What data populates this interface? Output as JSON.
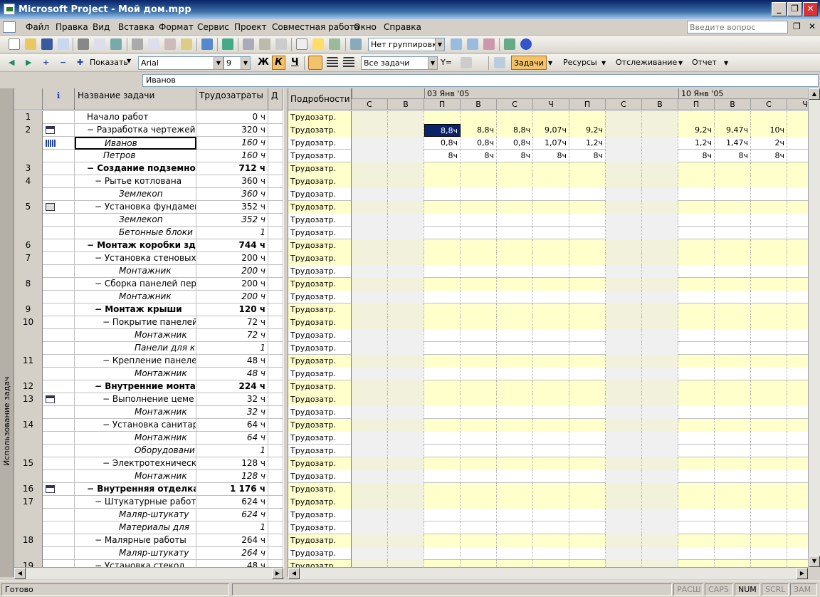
{
  "window": {
    "title": "Microsoft Project - Мой дом.mpp",
    "min": "_",
    "max": "❐",
    "close": "✕"
  },
  "menu": {
    "items": [
      "Файл",
      "Правка",
      "Вид",
      "Вставка",
      "Формат",
      "Сервис",
      "Проект",
      "Совместная работа",
      "Окно",
      "Справка"
    ],
    "ask_placeholder": "Введите вопрос"
  },
  "toolbar1": {
    "grouping": "Нет группировки"
  },
  "toolbar2": {
    "show_label": "Показать",
    "font": "Arial",
    "size": "9",
    "bold": "Ж",
    "italic": "К",
    "underline": "Ч",
    "filter": "Все задачи",
    "tasks": "Задачи",
    "resources": "Ресурсы",
    "tracking": "Отслеживание",
    "report": "Отчет"
  },
  "entry": {
    "value": "Иванов"
  },
  "view_name": "Использование задач",
  "table": {
    "headers": {
      "info": "ℹ",
      "name": "Название задачи",
      "work": "Трудозатраты",
      "d": "Д"
    },
    "rows": [
      {
        "id": "1",
        "name": "Начало работ",
        "work": "0 ч",
        "level": 1,
        "type": "task",
        "ind": ""
      },
      {
        "id": "2",
        "name": "− Разработка чертежей дом",
        "work": "320 ч",
        "level": 1,
        "type": "task",
        "ind": "calendar"
      },
      {
        "id": "",
        "name": "Иванов",
        "work": "160 ч",
        "level": 2,
        "type": "assign",
        "ind": "chart",
        "selected": true
      },
      {
        "id": "",
        "name": "Петров",
        "work": "160 ч",
        "level": 2,
        "type": "assign",
        "ind": ""
      },
      {
        "id": "3",
        "name": "− Создание подземной част",
        "work": "712 ч",
        "level": 1,
        "type": "summary",
        "ind": ""
      },
      {
        "id": "4",
        "name": "− Рытье котлована",
        "work": "360 ч",
        "level": 2,
        "type": "task",
        "ind": ""
      },
      {
        "id": "",
        "name": "Землекоп",
        "work": "360 ч",
        "level": 3,
        "type": "assign",
        "ind": ""
      },
      {
        "id": "5",
        "name": "− Установка фундамента",
        "work": "352 ч",
        "level": 2,
        "type": "task",
        "ind": "note"
      },
      {
        "id": "",
        "name": "Землекоп",
        "work": "352 ч",
        "level": 3,
        "type": "assign",
        "ind": ""
      },
      {
        "id": "",
        "name": "Бетонные блоки",
        "work": "1",
        "level": 3,
        "type": "assign",
        "ind": ""
      },
      {
        "id": "6",
        "name": "− Монтаж коробки здания",
        "work": "744 ч",
        "level": 1,
        "type": "summary",
        "ind": ""
      },
      {
        "id": "7",
        "name": "− Установка стеновых па",
        "work": "200 ч",
        "level": 2,
        "type": "task",
        "ind": ""
      },
      {
        "id": "",
        "name": "Монтажник",
        "work": "200 ч",
        "level": 3,
        "type": "assign",
        "ind": ""
      },
      {
        "id": "8",
        "name": "− Сборка панелей перек",
        "work": "200 ч",
        "level": 2,
        "type": "task",
        "ind": ""
      },
      {
        "id": "",
        "name": "Монтажник",
        "work": "200 ч",
        "level": 3,
        "type": "assign",
        "ind": ""
      },
      {
        "id": "9",
        "name": "− Монтаж крыши",
        "work": "120 ч",
        "level": 2,
        "type": "summary",
        "ind": ""
      },
      {
        "id": "10",
        "name": "− Покрытие панелей",
        "work": "72 ч",
        "level": 3,
        "type": "task",
        "ind": ""
      },
      {
        "id": "",
        "name": "Монтажник",
        "work": "72 ч",
        "level": 4,
        "type": "assign",
        "ind": ""
      },
      {
        "id": "",
        "name": "Панели для к",
        "work": "1",
        "level": 4,
        "type": "assign",
        "ind": ""
      },
      {
        "id": "11",
        "name": "− Крепление панеле",
        "work": "48 ч",
        "level": 3,
        "type": "task",
        "ind": ""
      },
      {
        "id": "",
        "name": "Монтажник",
        "work": "48 ч",
        "level": 4,
        "type": "assign",
        "ind": ""
      },
      {
        "id": "12",
        "name": "− Внутренние монтажны",
        "work": "224 ч",
        "level": 2,
        "type": "summary",
        "ind": ""
      },
      {
        "id": "13",
        "name": "− Выполнение цеме",
        "work": "32 ч",
        "level": 3,
        "type": "task",
        "ind": "calendar"
      },
      {
        "id": "",
        "name": "Монтажник",
        "work": "32 ч",
        "level": 4,
        "type": "assign",
        "ind": ""
      },
      {
        "id": "14",
        "name": "− Установка санитар",
        "work": "64 ч",
        "level": 3,
        "type": "task",
        "ind": ""
      },
      {
        "id": "",
        "name": "Монтажник",
        "work": "64 ч",
        "level": 4,
        "type": "assign",
        "ind": ""
      },
      {
        "id": "",
        "name": "Оборудовани",
        "work": "1",
        "level": 4,
        "type": "assign",
        "ind": ""
      },
      {
        "id": "15",
        "name": "− Электротехническ",
        "work": "128 ч",
        "level": 3,
        "type": "task",
        "ind": ""
      },
      {
        "id": "",
        "name": "Монтажник",
        "work": "128 ч",
        "level": 4,
        "type": "assign",
        "ind": ""
      },
      {
        "id": "16",
        "name": "− Внутренняя отделка здани",
        "work": "1 176 ч",
        "level": 1,
        "type": "summary",
        "ind": "calendar"
      },
      {
        "id": "17",
        "name": "− Штукатурные работы",
        "work": "624 ч",
        "level": 2,
        "type": "task",
        "ind": ""
      },
      {
        "id": "",
        "name": "Маляр-штукату",
        "work": "624 ч",
        "level": 3,
        "type": "assign",
        "ind": ""
      },
      {
        "id": "",
        "name": "Материалы для",
        "work": "1",
        "level": 3,
        "type": "assign",
        "ind": ""
      },
      {
        "id": "18",
        "name": "− Малярные работы",
        "work": "264 ч",
        "level": 2,
        "type": "task",
        "ind": ""
      },
      {
        "id": "",
        "name": "Маляр-штукату",
        "work": "264 ч",
        "level": 3,
        "type": "assign",
        "ind": ""
      },
      {
        "id": "19",
        "name": "− Установка стекол",
        "work": "48 ч",
        "level": 2,
        "type": "task",
        "ind": ""
      }
    ]
  },
  "timescale": {
    "details_header": "Подробности",
    "detail_label": "Трудозатр.",
    "weeks": [
      {
        "label": "",
        "start": 0
      },
      {
        "label": "03 Янв '05",
        "start": 2
      },
      {
        "label": "10 Янв '05",
        "start": 9
      }
    ],
    "days": [
      "С",
      "В",
      "П",
      "В",
      "С",
      "Ч",
      "П",
      "С",
      "В",
      "П",
      "В",
      "С",
      "Ч"
    ],
    "nonwork": [
      0,
      1,
      7,
      8
    ],
    "values": {
      "1": [
        "",
        "",
        "8,8ч",
        "8,8ч",
        "8,8ч",
        "9,07ч",
        "9,2ч",
        "",
        "",
        "9,2ч",
        "9,47ч",
        "10ч",
        ""
      ],
      "2": [
        "",
        "",
        "0,8ч",
        "0,8ч",
        "0,8ч",
        "1,07ч",
        "1,2ч",
        "",
        "",
        "1,2ч",
        "1,47ч",
        "2ч",
        ""
      ],
      "3": [
        "",
        "",
        "8ч",
        "8ч",
        "8ч",
        "8ч",
        "8ч",
        "",
        "",
        "8ч",
        "8ч",
        "8ч",
        ""
      ]
    }
  },
  "status": {
    "ready": "Готово",
    "panes": [
      "РАСШ",
      "CAPS",
      "NUM",
      "SCRL",
      "ЗАМ"
    ]
  }
}
